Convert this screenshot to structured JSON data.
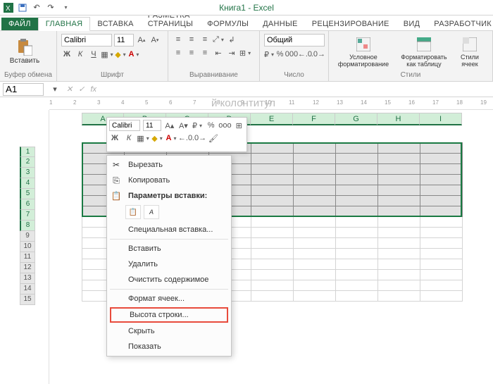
{
  "app": {
    "title": "Книга1 - Excel"
  },
  "tabs": {
    "file": "ФАЙЛ",
    "home": "ГЛАВНАЯ",
    "insert": "ВСТАВКА",
    "layout": "РАЗМЕТКА СТРАНИЦЫ",
    "formulas": "ФОРМУЛЫ",
    "data": "ДАННЫЕ",
    "review": "РЕЦЕНЗИРОВАНИЕ",
    "view": "ВИД",
    "dev": "РАЗРАБОТЧИК"
  },
  "ribbon": {
    "clipboard": {
      "paste": "Вставить",
      "label": "Буфер обмена"
    },
    "font": {
      "name": "Calibri",
      "size": "11",
      "label": "Шрифт"
    },
    "align": {
      "label": "Выравнивание"
    },
    "number": {
      "format": "Общий",
      "label": "Число"
    },
    "styles": {
      "cond": "Условное\nформатирование",
      "table": "Форматировать\nкак таблицу",
      "cell": "Стили\nячеек",
      "label": "Стили"
    }
  },
  "namebox": "A1",
  "fx": "fx",
  "ruler": [
    1,
    2,
    3,
    4,
    5,
    6,
    7,
    8,
    9,
    10,
    11,
    12,
    13,
    14,
    15,
    16,
    17,
    18,
    19
  ],
  "cols": [
    "A",
    "B",
    "C",
    "D",
    "E",
    "F",
    "G",
    "H",
    "I"
  ],
  "rows": [
    1,
    2,
    3,
    4,
    5,
    6,
    7,
    8,
    9,
    10,
    11,
    12,
    13,
    14,
    15
  ],
  "pagetitle": "й колонтитул",
  "mini": {
    "font": "Calibri",
    "size": "11"
  },
  "ctx": {
    "cut": "Вырезать",
    "copy": "Копировать",
    "pasteops": "Параметры вставки:",
    "special": "Специальная вставка...",
    "insert": "Вставить",
    "delete": "Удалить",
    "clear": "Очистить содержимое",
    "format": "Формат ячеек...",
    "height": "Высота строки...",
    "hide": "Скрыть",
    "show": "Показать"
  }
}
